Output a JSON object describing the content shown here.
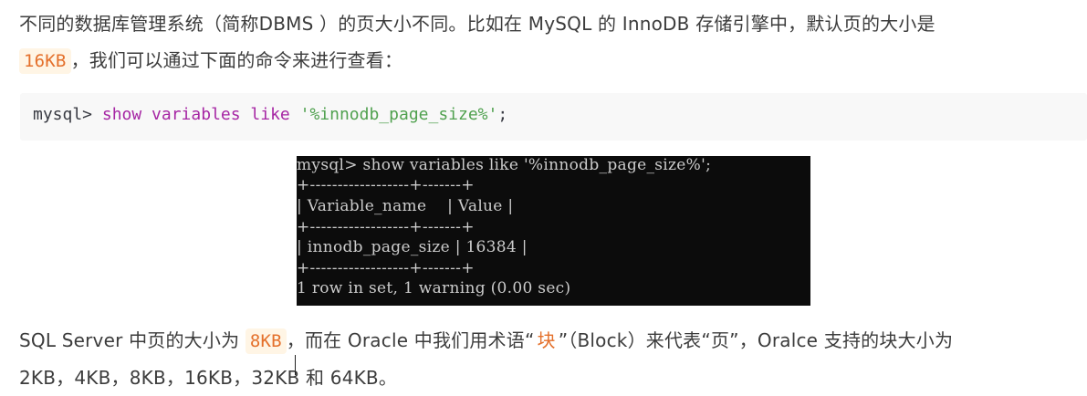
{
  "para1": {
    "line1": "不同的数据库管理系统（简称DBMS ）的页大小不同。比如在 MySQL 的 InnoDB 存储引擎中，默认页的大小是",
    "tag": "16KB",
    "line2_rest": "，我们可以通过下面的命令来进行查看："
  },
  "code": {
    "prompt": "mysql> ",
    "kw1": "show variables like",
    "space": " ",
    "str": "'%innodb_page_size%'",
    "semi": ";"
  },
  "terminal": {
    "lines": [
      "mysql> show variables like '%innodb_page_size%';",
      "+------------------+-------+",
      "| Variable_name    | Value |",
      "+------------------+-------+",
      "| innodb_page_size | 16384 |",
      "+------------------+-------+",
      "1 row in set, 1 warning (0.00 sec)"
    ]
  },
  "para2": {
    "text1": "SQL Server 中页的大小为",
    "tag": "8KB",
    "text2": "，而在 Oracle 中我们用术语“",
    "highlight": "块",
    "text3": "”（Block）来代表“页”，Oralce 支持的块大小为",
    "line2": "2KB，4KB，8KB，16KB，32KB 和 64KB。"
  },
  "colors": {
    "tag_text": "#e4702b",
    "tag_bg": "#fff5e5",
    "keyword": "#a626a4",
    "string": "#50a14f",
    "terminal_bg": "#0c0c0c"
  }
}
